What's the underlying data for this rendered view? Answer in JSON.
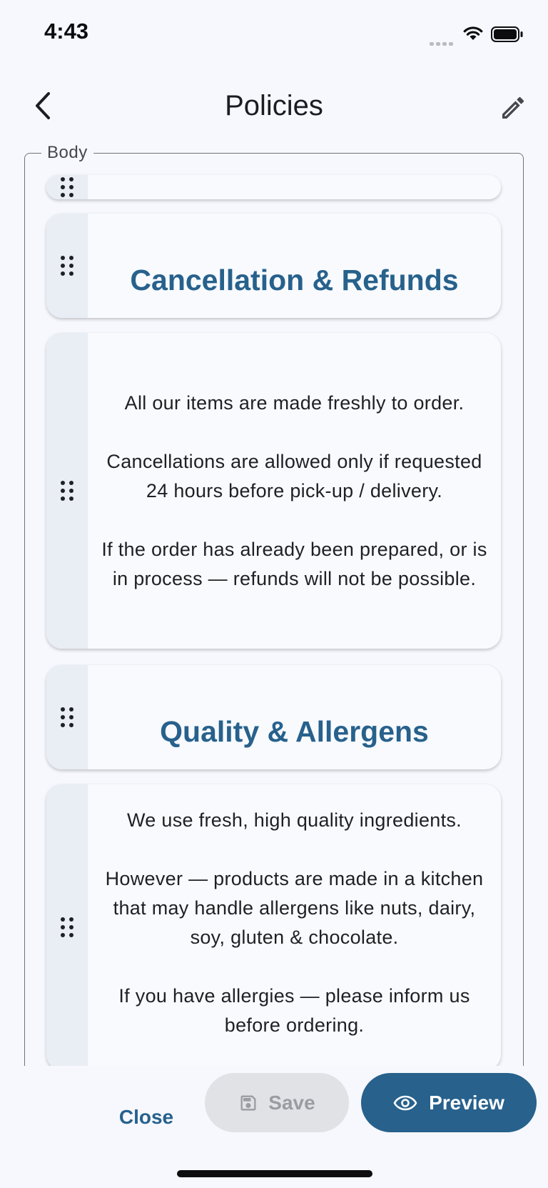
{
  "status_bar": {
    "time": "4:43"
  },
  "app_bar": {
    "title": "Policies"
  },
  "field": {
    "label": "Body"
  },
  "blocks": [
    {
      "type": "empty",
      "text": ""
    },
    {
      "type": "heading",
      "text": "Cancellation & Refunds"
    },
    {
      "type": "paragraph",
      "text": "All our items are made freshly to order.\n\nCancellations are allowed only if requested 24 hours before pick-up / delivery.\n\nIf the order has already been prepared, or is in process — refunds will not be possible."
    },
    {
      "type": "heading",
      "text": "Quality & Allergens"
    },
    {
      "type": "paragraph",
      "text": "We use fresh, high quality ingredients.\n\nHowever — products are made in a kitchen that may handle allergens like nuts, dairy, soy, gluten & chocolate.\n\nIf you have allergies — please inform us before ordering."
    }
  ],
  "actions": {
    "close_label": "Close",
    "save_label": "Save",
    "preview_label": "Preview"
  },
  "colors": {
    "accent": "#27618c",
    "background": "#f6f8fd",
    "handle": "#e9eef5"
  },
  "icons": [
    "back-arrow-icon",
    "pencil-icon",
    "drag-handle-icon",
    "save-icon",
    "eye-icon",
    "wifi-icon",
    "battery-icon"
  ]
}
